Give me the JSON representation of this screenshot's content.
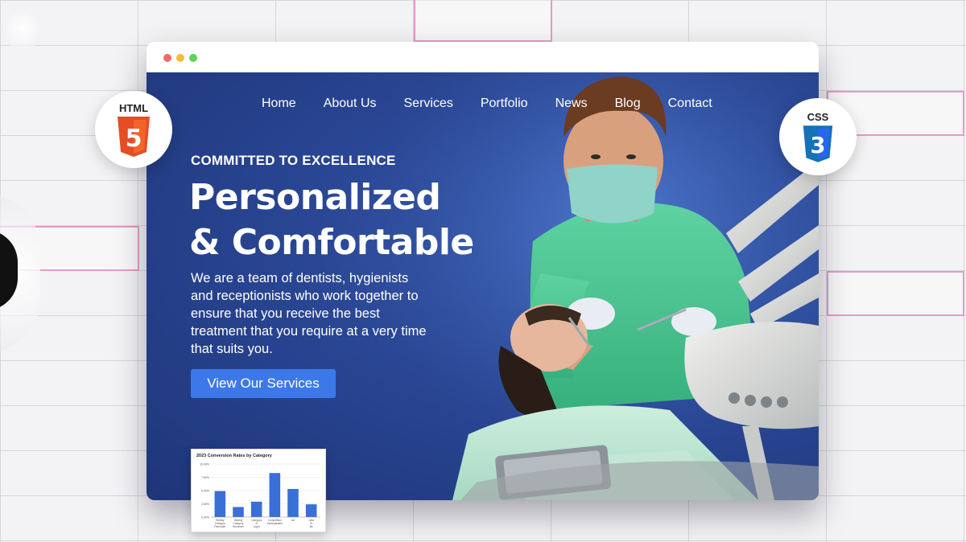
{
  "nav": {
    "items": [
      "Home",
      "About Us",
      "Services",
      "Portfolio",
      "News",
      "Blog",
      "Contact"
    ]
  },
  "hero": {
    "eyebrow": "COMMITTED TO EXCELLENCE",
    "headline_line1": "Personalized",
    "headline_line2": "& Comfortable",
    "body": "We are a team of dentists, hygienists and receptionists who work together to ensure that you receive the best treatment that you require at a very time that suits you.",
    "cta_label": "View Our Services"
  },
  "badges": {
    "html_label": "HTML",
    "html_number": "5",
    "css_label": "CSS",
    "css_number": "3"
  },
  "colors": {
    "accent": "#3c78e8",
    "hero_blue": "#2a4795",
    "html_orange": "#e44d26",
    "css_blue": "#2965f1",
    "bar_blue": "#3a6fd8"
  },
  "chart_data": {
    "type": "bar",
    "title": "2023 Conversion Rates by Category",
    "categories": [
      "Weekly Category Reminder",
      "Weekly Category Reminder",
      "Category A Login Special",
      "Competition Sweepstakes",
      "Ad",
      "Jobs To Be Done"
    ],
    "values": [
      4.9,
      1.9,
      2.9,
      8.3,
      5.3,
      2.4
    ],
    "ylim": [
      0,
      10
    ],
    "ytick_labels": [
      "0.00%",
      "2.50%",
      "5.00%",
      "7.50%",
      "10.00%"
    ],
    "xlabel": "",
    "ylabel": "",
    "grid": true
  }
}
